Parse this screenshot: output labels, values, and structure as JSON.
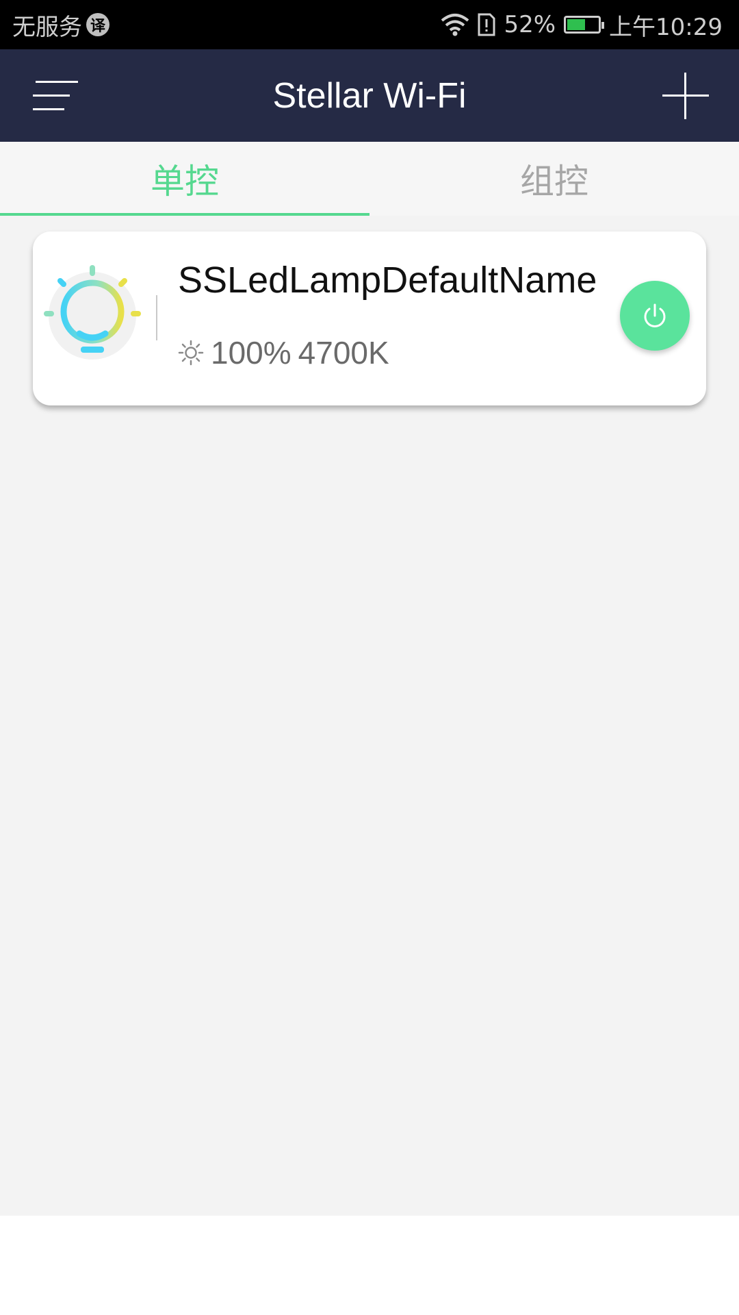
{
  "status_bar": {
    "carrier": "无服务",
    "badge": "译",
    "battery_percent": "52%",
    "battery_level": 0.52,
    "time": "上午10:29"
  },
  "app_bar": {
    "title": "Stellar Wi-Fi",
    "color": "#252a45"
  },
  "tabs": [
    {
      "label": "单控",
      "active": true
    },
    {
      "label": "组控",
      "active": false
    }
  ],
  "accent_color": "#55d88f",
  "devices": [
    {
      "name": "SSLedLampDefaultName",
      "brightness": "100%",
      "color_temp": "4700K",
      "icon": "light-bulb-icon",
      "power_on": true
    }
  ]
}
